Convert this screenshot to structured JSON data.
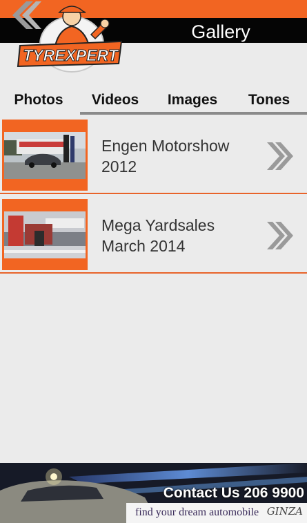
{
  "header": {
    "title": "Gallery",
    "logo_text": "TYREXPERT",
    "back_icon": "double-chevron-left-icon"
  },
  "tabs": [
    {
      "label": "Photos",
      "selected": false
    },
    {
      "label": "Videos",
      "selected": true
    },
    {
      "label": "Images",
      "selected": true
    },
    {
      "label": "Tones",
      "selected": true
    }
  ],
  "albums": [
    {
      "title": "Engen Motorshow 2012",
      "chevron_icon": "double-chevron-right-icon"
    },
    {
      "title": "Mega Yardsales March 2014",
      "chevron_icon": "double-chevron-right-icon"
    }
  ],
  "ad_banner": {
    "contact": "Contact Us 206 9900",
    "tagline": "find your dream automobile",
    "brand": "GINZA"
  },
  "colors": {
    "accent": "#f26522",
    "header_bar": "#050505",
    "background": "#ebebeb",
    "divider": "#e8632a",
    "chevron": "#9a9a9a"
  }
}
